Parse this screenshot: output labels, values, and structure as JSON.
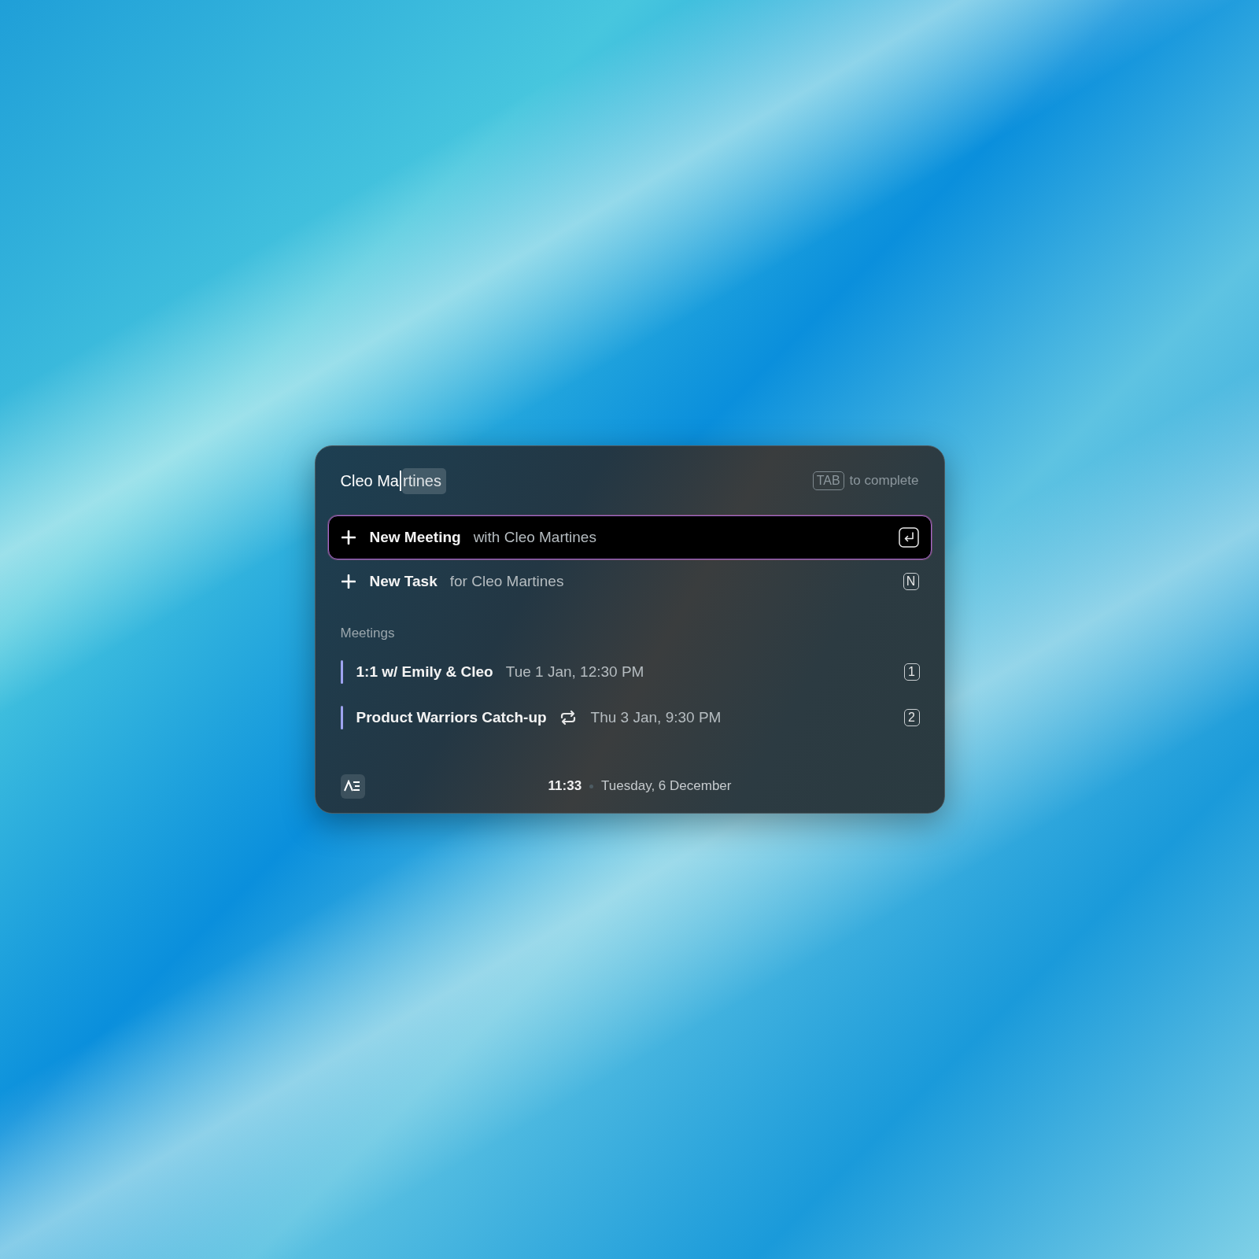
{
  "search": {
    "value": "Cleo Ma",
    "completion": "rtines",
    "hint_key": "TAB",
    "hint_text": "to complete"
  },
  "actions": [
    {
      "title": "New Meeting",
      "detail": "with Cleo Martines",
      "kind": "return",
      "selected": true
    },
    {
      "title": "New Task",
      "detail": "for Cleo Martines",
      "kind": "key",
      "shortcut": "N",
      "selected": false
    }
  ],
  "meetings": {
    "heading": "Meetings",
    "items": [
      {
        "title": "1:1 w/ Emily & Cleo",
        "recurring": false,
        "time": "Tue 1 Jan, 12:30 PM",
        "shortcut": "1",
        "color": "#9ea3f0"
      },
      {
        "title": "Product Warriors Catch-up",
        "recurring": true,
        "time": "Thu 3 Jan, 9:30 PM",
        "shortcut": "2",
        "color": "#9ea3f0"
      }
    ]
  },
  "footer": {
    "time": "11:33",
    "date": "Tuesday, 6 December"
  }
}
